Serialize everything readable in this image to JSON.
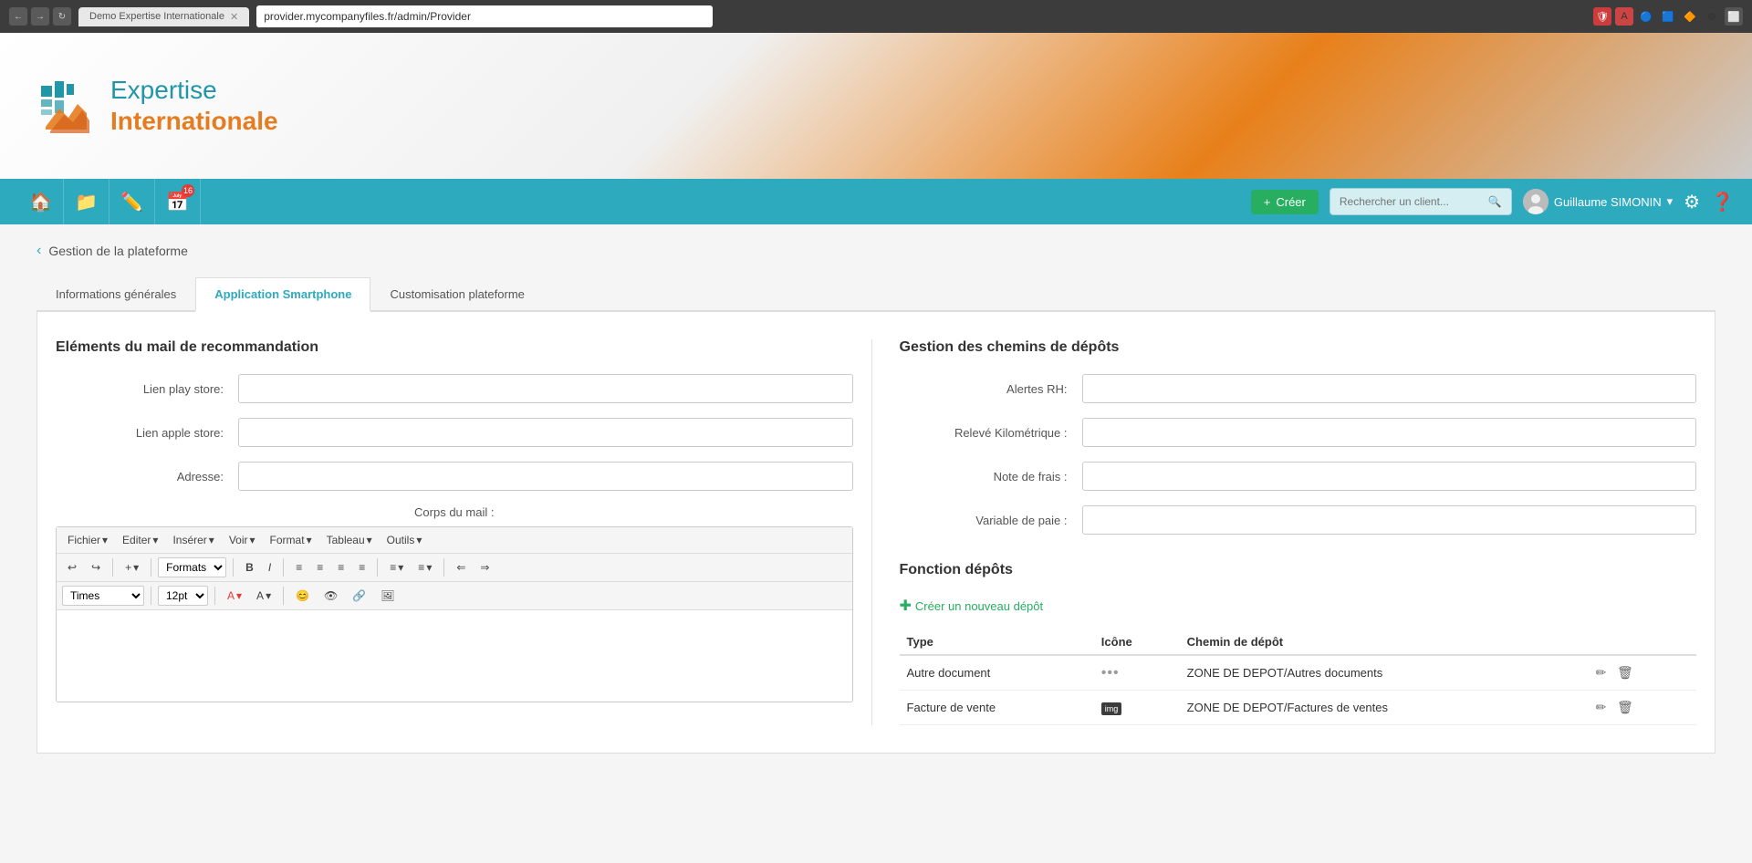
{
  "browser": {
    "tab_title": "Demo Expertise Internationale",
    "url": "provider.mycompanyfiles.fr/admin/Provider"
  },
  "header": {
    "logo_line1": "Expertise",
    "logo_line2": "Internationale"
  },
  "nav": {
    "create_label": "Créer",
    "search_placeholder": "Rechercher un client...",
    "user_name": "Guillaume SIMONIN"
  },
  "breadcrumb": {
    "back_label": "‹",
    "title": "Gestion de la plateforme"
  },
  "tabs": [
    {
      "id": "informations",
      "label": "Informations générales"
    },
    {
      "id": "smartphone",
      "label": "Application Smartphone"
    },
    {
      "id": "customisation",
      "label": "Customisation plateforme"
    }
  ],
  "left_panel": {
    "section_title": "Eléments du mail de recommandation",
    "fields": [
      {
        "label": "Lien play store:",
        "value": ""
      },
      {
        "label": "Lien apple store:",
        "value": ""
      },
      {
        "label": "Adresse:",
        "value": ""
      }
    ],
    "corps_du_mail": "Corps du mail :",
    "editor": {
      "menus": [
        "Fichier",
        "Editer",
        "Insérer",
        "Voir",
        "Format",
        "Tableau",
        "Outils"
      ],
      "font_family": "Times",
      "font_size": "12pt",
      "format_label": "Formats"
    }
  },
  "right_panel": {
    "gestion_title": "Gestion des chemins de dépôts",
    "fields": [
      {
        "label": "Alertes RH:",
        "value": ""
      },
      {
        "label": "Relevé Kilométrique :",
        "value": ""
      },
      {
        "label": "Note de frais :",
        "value": ""
      },
      {
        "label": "Variable de paie :",
        "value": ""
      }
    ],
    "fonction_title": "Fonction dépôts",
    "create_depot": "Créer un nouveau dépôt",
    "table_headers": [
      "Type",
      "Icône",
      "Chemin de dépôt"
    ],
    "depot_rows": [
      {
        "type": "Autre document",
        "icone": "dots",
        "chemin": "ZONE DE DEPOT/Autres documents"
      },
      {
        "type": "Facture de vente",
        "icone": "img",
        "chemin": "ZONE DE DEPOT/Factures de ventes"
      }
    ]
  }
}
